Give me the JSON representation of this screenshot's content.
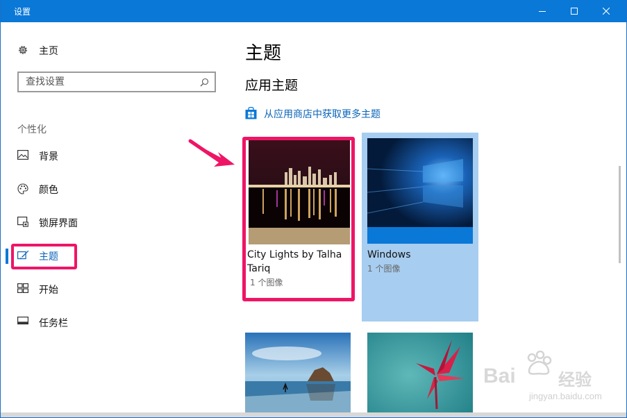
{
  "window": {
    "title": "设置"
  },
  "sidebar": {
    "home_label": "主页",
    "search_placeholder": "查找设置",
    "section_label": "个性化",
    "items": [
      {
        "label": "背景",
        "icon": "picture-icon"
      },
      {
        "label": "颜色",
        "icon": "palette-icon"
      },
      {
        "label": "锁屏界面",
        "icon": "lock-screen-icon"
      },
      {
        "label": "主题",
        "icon": "theme-brush-icon",
        "active": true
      },
      {
        "label": "开始",
        "icon": "start-tiles-icon"
      },
      {
        "label": "任务栏",
        "icon": "taskbar-icon"
      }
    ]
  },
  "main": {
    "page_title": "主题",
    "section_title": "应用主题",
    "store_link": "从应用商店中获取更多主题",
    "themes": [
      {
        "name": "City Lights by Talha Tariq",
        "count": "1 个图像",
        "accent": "#b59c74"
      },
      {
        "name": "Windows",
        "count": "1 个图像",
        "selected": true,
        "accent": "#0a78d7"
      }
    ]
  },
  "watermark": {
    "brand": "Bai",
    "brand_cn": "经验",
    "url": "jingyan.baidu.com"
  },
  "colors": {
    "titlebar": "#0a78d7",
    "accent": "#0a63b8",
    "highlight": "#ee1566"
  }
}
